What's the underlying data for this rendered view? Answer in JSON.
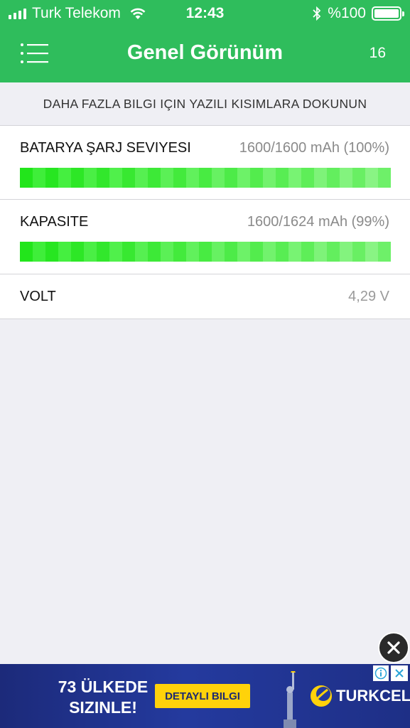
{
  "status_bar": {
    "carrier": "Turk Telekom",
    "time": "12:43",
    "battery_text": "%100",
    "battery_level": 1.0
  },
  "nav": {
    "title": "Genel Görünüm",
    "count": "16",
    "menu_icon": "hamburger-menu-icon"
  },
  "hint": "DAHA FAZLA BILGI IÇIN YAZILI KISIMLARA DOKUNUN",
  "rows": {
    "charge": {
      "label": "BATARYA ŞARJ SEVIYESI",
      "value": "1600/1600 mAh (100%)",
      "level": 1.0
    },
    "capacity": {
      "label": "KAPASITE",
      "value": "1600/1624 mAh (99%)",
      "level": 0.99
    },
    "volt": {
      "label": "VOLT",
      "value": "4,29 V"
    }
  },
  "ad": {
    "headline_line1": "73 ÜLKEDE",
    "headline_line2": "SIZINLE!",
    "cta": "DETAYLI BILGI",
    "brand": "TURKCELL"
  },
  "colors": {
    "accent": "#2fbd5c",
    "bar_bright": "#22e51b",
    "bar_light": "#7ff07a",
    "ad_bg": "#243a9e",
    "ad_cta": "#ffd20a"
  }
}
